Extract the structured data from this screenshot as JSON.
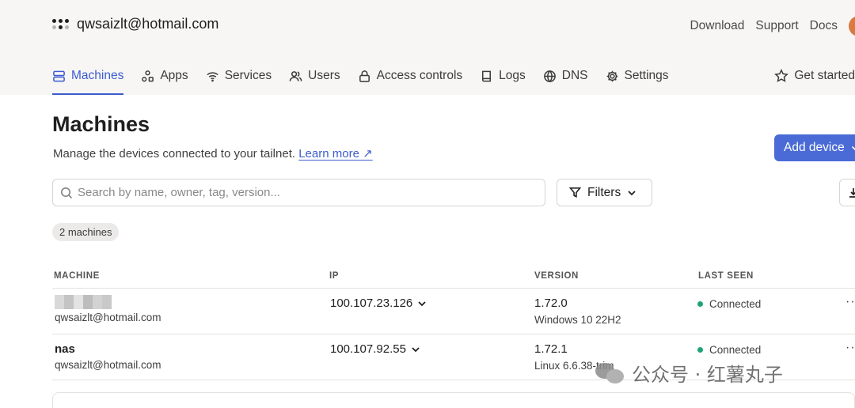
{
  "header": {
    "account": "qwsaizlt@hotmail.com",
    "links": [
      "Download",
      "Support",
      "Docs"
    ]
  },
  "tabs": [
    {
      "label": "Machines",
      "icon": "machines-icon",
      "active": true
    },
    {
      "label": "Apps",
      "icon": "apps-icon"
    },
    {
      "label": "Services",
      "icon": "wifi-icon"
    },
    {
      "label": "Users",
      "icon": "users-icon"
    },
    {
      "label": "Access controls",
      "icon": "lock-icon"
    },
    {
      "label": "Logs",
      "icon": "book-icon"
    },
    {
      "label": "DNS",
      "icon": "globe-icon"
    },
    {
      "label": "Settings",
      "icon": "gear-icon"
    }
  ],
  "get_started": "Get started",
  "page": {
    "title": "Machines",
    "subtitle": "Manage the devices connected to your tailnet.",
    "learn_more": "Learn more ↗",
    "add_device": "Add device"
  },
  "search": {
    "placeholder": "Search by name, owner, tag, version..."
  },
  "filters_label": "Filters",
  "machine_count": "2 machines",
  "table": {
    "headers": {
      "machine": "MACHINE",
      "ip": "IP",
      "version": "VERSION",
      "last_seen": "LAST SEEN"
    },
    "rows": [
      {
        "name": "",
        "name_redacted": true,
        "owner": "qwsaizlt@hotmail.com",
        "ip": "100.107.23.126",
        "version": "1.72.0",
        "os": "Windows 10 22H2",
        "status": "Connected"
      },
      {
        "name": "nas",
        "name_redacted": false,
        "owner": "qwsaizlt@hotmail.com",
        "ip": "100.107.92.55",
        "version": "1.72.1",
        "os": "Linux 6.6.38-trim",
        "status": "Connected"
      }
    ]
  },
  "watermark": "公众号 · 红薯丸子",
  "colors": {
    "accent": "#3c5ccf",
    "button": "#4a6bd6",
    "connected": "#1fa37a",
    "topbar_bg": "#f7f6f5"
  }
}
